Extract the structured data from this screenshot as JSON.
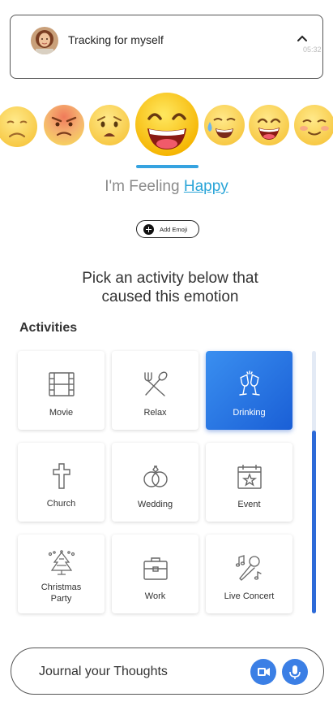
{
  "tracking": {
    "label": "Tracking for myself",
    "time": "05:32"
  },
  "emojis": [
    {
      "name": "frown-emoji"
    },
    {
      "name": "angry-emoji"
    },
    {
      "name": "worried-emoji"
    },
    {
      "name": "happy-emoji",
      "selected": true
    },
    {
      "name": "sweat-smile-emoji"
    },
    {
      "name": "grin-emoji"
    },
    {
      "name": "blush-emoji"
    }
  ],
  "feeling": {
    "prefix": "I'm Feeling",
    "mood": "Happy"
  },
  "add_emoji": {
    "label": "Add Emoji"
  },
  "prompt": {
    "line1": "Pick an activity below that",
    "line2": "caused this emotion"
  },
  "activities": {
    "title": "Activities",
    "items": [
      {
        "label": "Movie",
        "icon": "film-icon"
      },
      {
        "label": "Relax",
        "icon": "utensils-icon"
      },
      {
        "label": "Drinking",
        "icon": "champagne-icon",
        "selected": true
      },
      {
        "label": "Church",
        "icon": "cross-icon"
      },
      {
        "label": "Wedding",
        "icon": "rings-icon"
      },
      {
        "label": "Event",
        "icon": "calendar-star-icon"
      },
      {
        "label": "Christmas",
        "label2": "Party",
        "icon": "christmas-tree-icon"
      },
      {
        "label": "Work",
        "icon": "briefcase-icon"
      },
      {
        "label": "Live Concert",
        "icon": "microphone-notes-icon"
      }
    ]
  },
  "journal": {
    "placeholder": "Journal your Thoughts"
  },
  "colors": {
    "accent": "#2aa5d8",
    "selected_tile": "#2d6ad8",
    "button": "#3b7fe5"
  }
}
